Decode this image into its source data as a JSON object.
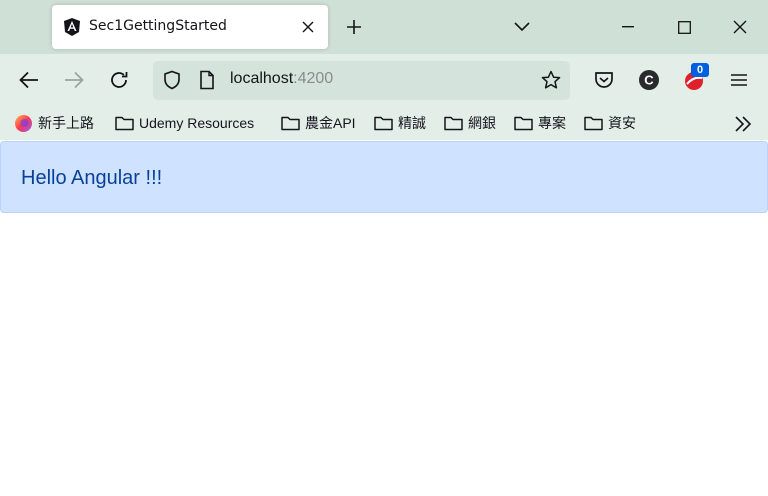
{
  "browser": {
    "tab": {
      "title": "Sec1GettingStarted",
      "favicon": "angular-icon"
    },
    "url": {
      "host": "localhost",
      "port": ":4200"
    },
    "extension_badge": "0",
    "bookmarks": [
      {
        "label": "新手上路",
        "icon": "firefox-icon"
      },
      {
        "label": "Udemy Resources",
        "icon": "folder-icon"
      },
      {
        "label": "農金API",
        "icon": "folder-icon"
      },
      {
        "label": "精誠",
        "icon": "folder-icon"
      },
      {
        "label": "網銀",
        "icon": "folder-icon"
      },
      {
        "label": "專案",
        "icon": "folder-icon"
      },
      {
        "label": "資安",
        "icon": "folder-icon"
      }
    ]
  },
  "page": {
    "alert_text": "Hello Angular !!!",
    "colors": {
      "alert_bg": "#cfe2ff",
      "alert_border": "#b6d4fe",
      "alert_text": "#084298"
    }
  }
}
